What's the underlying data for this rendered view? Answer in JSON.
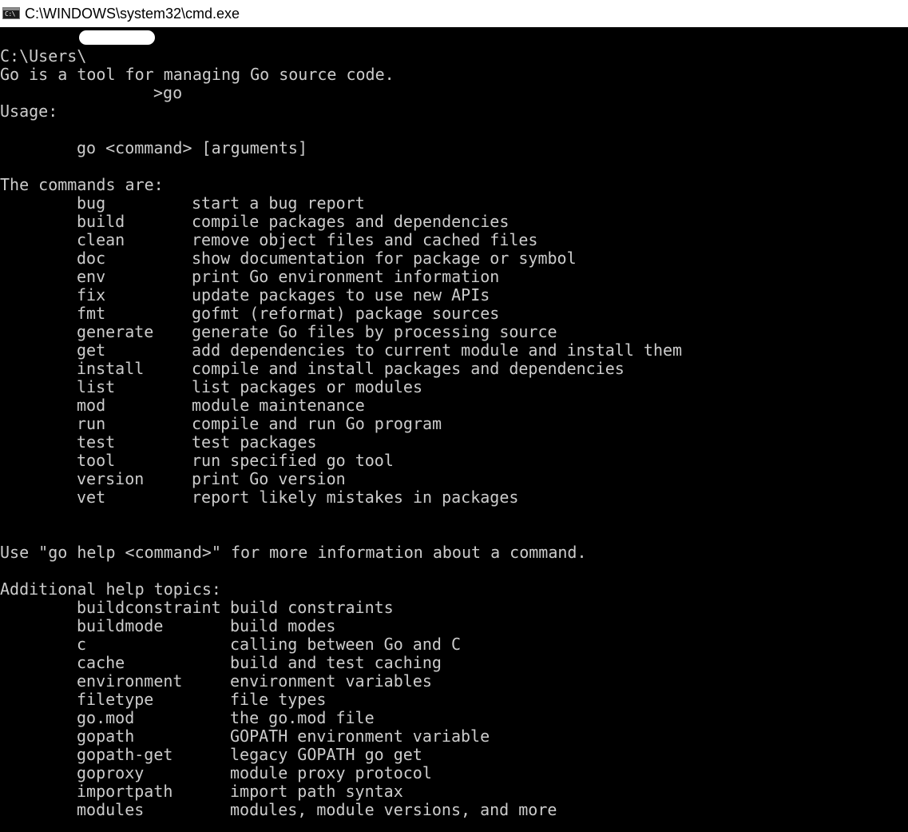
{
  "window": {
    "title": "C:\\WINDOWS\\system32\\cmd.exe",
    "icon": "cmd-console-icon",
    "icon_text": "C:\\"
  },
  "console": {
    "prompt_prefix": "C:\\Users\\",
    "prompt_suffix": ">go",
    "intro": "Go is a tool for managing Go source code.",
    "usage_heading": "Usage:",
    "usage_line": "go <command> [arguments]",
    "commands_heading": "The commands are:",
    "commands": [
      {
        "name": "bug",
        "desc": "start a bug report"
      },
      {
        "name": "build",
        "desc": "compile packages and dependencies"
      },
      {
        "name": "clean",
        "desc": "remove object files and cached files"
      },
      {
        "name": "doc",
        "desc": "show documentation for package or symbol"
      },
      {
        "name": "env",
        "desc": "print Go environment information"
      },
      {
        "name": "fix",
        "desc": "update packages to use new APIs"
      },
      {
        "name": "fmt",
        "desc": "gofmt (reformat) package sources"
      },
      {
        "name": "generate",
        "desc": "generate Go files by processing source"
      },
      {
        "name": "get",
        "desc": "add dependencies to current module and install them"
      },
      {
        "name": "install",
        "desc": "compile and install packages and dependencies"
      },
      {
        "name": "list",
        "desc": "list packages or modules"
      },
      {
        "name": "mod",
        "desc": "module maintenance"
      },
      {
        "name": "run",
        "desc": "compile and run Go program"
      },
      {
        "name": "test",
        "desc": "test packages"
      },
      {
        "name": "tool",
        "desc": "run specified go tool"
      },
      {
        "name": "version",
        "desc": "print Go version"
      },
      {
        "name": "vet",
        "desc": "report likely mistakes in packages"
      }
    ],
    "help_hint": "Use \"go help <command>\" for more information about a command.",
    "topics_heading": "Additional help topics:",
    "topics": [
      {
        "name": "buildconstraint",
        "desc": "build constraints"
      },
      {
        "name": "buildmode",
        "desc": "build modes"
      },
      {
        "name": "c",
        "desc": "calling between Go and C"
      },
      {
        "name": "cache",
        "desc": "build and test caching"
      },
      {
        "name": "environment",
        "desc": "environment variables"
      },
      {
        "name": "filetype",
        "desc": "file types"
      },
      {
        "name": "go.mod",
        "desc": "the go.mod file"
      },
      {
        "name": "gopath",
        "desc": "GOPATH environment variable"
      },
      {
        "name": "gopath-get",
        "desc": "legacy GOPATH go get"
      },
      {
        "name": "goproxy",
        "desc": "module proxy protocol"
      },
      {
        "name": "importpath",
        "desc": "import path syntax"
      },
      {
        "name": "modules",
        "desc": "modules, module versions, and more"
      }
    ]
  },
  "colors": {
    "console_bg": "#000000",
    "console_fg": "#cccccc",
    "titlebar_bg": "#ffffff"
  }
}
